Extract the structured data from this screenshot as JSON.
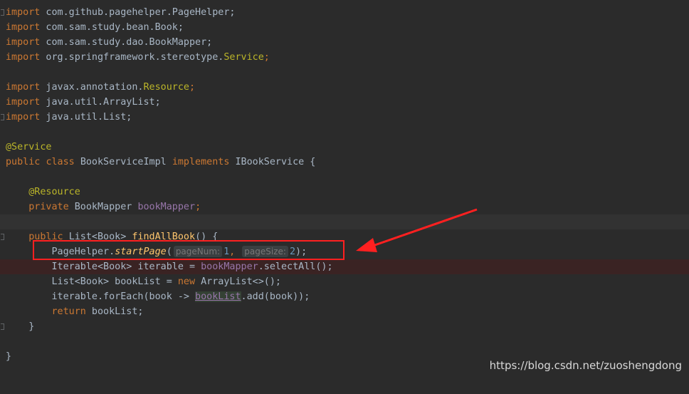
{
  "editor": {
    "lines": [
      {
        "kw": "import",
        "rest": " com.github.pagehelper.PageHelper;"
      },
      {
        "kw": "import",
        "rest": " com.sam.study.bean.Book;"
      },
      {
        "kw": "import",
        "rest": " com.sam.study.dao.BookMapper;"
      },
      {
        "kw": "import",
        "rest": " org.springframework.stereotype.",
        "cls": "Service",
        "end": ";"
      },
      {
        "kw": "import",
        "rest": " javax.annotation.",
        "cls": "Resource",
        "end": ";"
      },
      {
        "kw": "import",
        "rest": " java.util.ArrayList;"
      },
      {
        "kw": "import",
        "rest": " java.util.List;"
      },
      {
        "annotation": "@Service"
      },
      {
        "kw1": "public",
        "kw2": "class",
        "name": "BookServiceImpl",
        "kw3": "implements",
        "iface": "IBookService {"
      },
      {
        "annotation": "@Resource"
      },
      {
        "kw": "private",
        "type": "BookMapper",
        "field": "bookMapper",
        "end": ";"
      },
      {
        "kw": "public",
        "sig": "List<Book>",
        "method": "findAllBook",
        "end": "() {"
      },
      {
        "cls": "PageHelper.",
        "method": "startPage",
        "open": "(",
        "hint1": "pageNum:",
        "val1": "1",
        "sep": ", ",
        "hint2": "pageSize:",
        "val2": "2",
        "close": ");"
      },
      {
        "pre": "Iterable<Book> iterable = ",
        "field": "bookMapper",
        "post": ".selectAll();"
      },
      {
        "pre": "List<Book> bookList = ",
        "kw": "new",
        "post": " ArrayList<>();"
      },
      {
        "pre": "iterable.forEach(book -> ",
        "field": "bookList",
        "post": ".add(book));"
      },
      {
        "kw": "return",
        "post": " bookList;"
      },
      {
        "brace": "}"
      },
      {
        "brace": "}"
      }
    ]
  },
  "watermark": "https://blog.csdn.net/zuoshengdong",
  "colors": {
    "background": "#2b2b2b",
    "keyword": "#cc7832",
    "annotation": "#bbb529",
    "highlight_box": "#ff2020",
    "arrow": "#ff2020"
  }
}
